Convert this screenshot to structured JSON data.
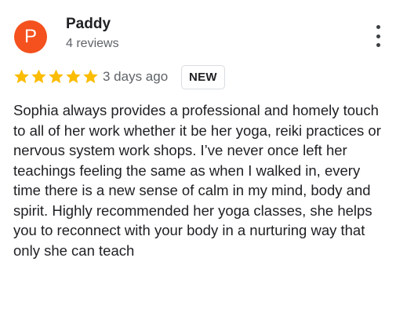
{
  "reviewer": {
    "initial": "P",
    "name": "Paddy",
    "reviews_count": "4 reviews",
    "avatar_color": "#f4511e"
  },
  "rating": {
    "stars": 5,
    "max": 5,
    "star_color": "#fbbc04"
  },
  "review": {
    "date": "3 days ago",
    "badge": "NEW",
    "text": "Sophia always provides a professional and homely touch to all of her work whether it be her yoga, reiki practices or nervous system work shops. I’ve never once left her teachings feeling the same as when I walked in, every time there is a new sense of calm in my mind, body and spirit. Highly recommended her yoga classes, she helps you to reconnect with your body in a nurturing way that only she can teach"
  },
  "menu": {
    "icon": "more-vert-icon"
  }
}
